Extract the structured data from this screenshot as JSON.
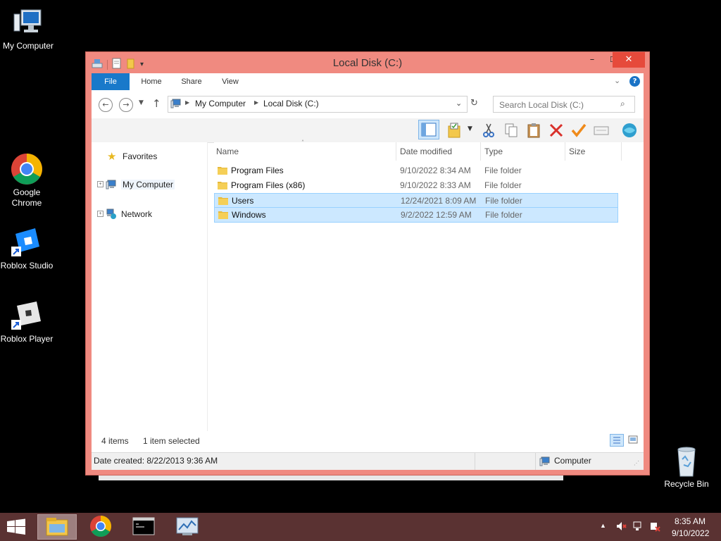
{
  "desktop": {
    "icons": [
      {
        "label": "My Computer"
      },
      {
        "label": "Google Chrome"
      },
      {
        "label": "Roblox Studio"
      },
      {
        "label": "Roblox Player"
      },
      {
        "label": "Recycle Bin"
      }
    ]
  },
  "window": {
    "title": "Local Disk (C:)",
    "controls": {
      "minimize": "–",
      "maximize": "☐",
      "close": "✕"
    },
    "ribbon_tabs": [
      "File",
      "Home",
      "Share",
      "View"
    ],
    "address": {
      "crumbs": [
        "My Computer",
        "Local Disk (C:)"
      ]
    },
    "search": {
      "placeholder": "Search Local Disk (C:)"
    },
    "nav": [
      "Favorites",
      "My Computer",
      "Network"
    ],
    "columns": [
      "Name",
      "Date modified",
      "Type",
      "Size"
    ],
    "files": [
      {
        "name": "Program Files",
        "date": "9/10/2022 8:34 AM",
        "type": "File folder",
        "selected": false
      },
      {
        "name": "Program Files (x86)",
        "date": "9/10/2022 8:33 AM",
        "type": "File folder",
        "selected": false
      },
      {
        "name": "Users",
        "date": "12/24/2021 8:09 AM",
        "type": "File folder",
        "selected": true
      },
      {
        "name": "Windows",
        "date": "9/2/2022 12:59 AM",
        "type": "File folder",
        "selected": true
      }
    ],
    "status": {
      "items": "4 items",
      "selected": "1 item selected"
    },
    "details": {
      "created": "Date created: 8/22/2013 9:36 AM",
      "location": "Computer"
    }
  },
  "taskbar": {
    "time": "8:35 AM",
    "date": "9/10/2022"
  },
  "colors": {
    "accent": "#1979ca",
    "titlebar": "#f08a80",
    "taskbar": "#5a3232",
    "selection": "#cce8ff"
  }
}
